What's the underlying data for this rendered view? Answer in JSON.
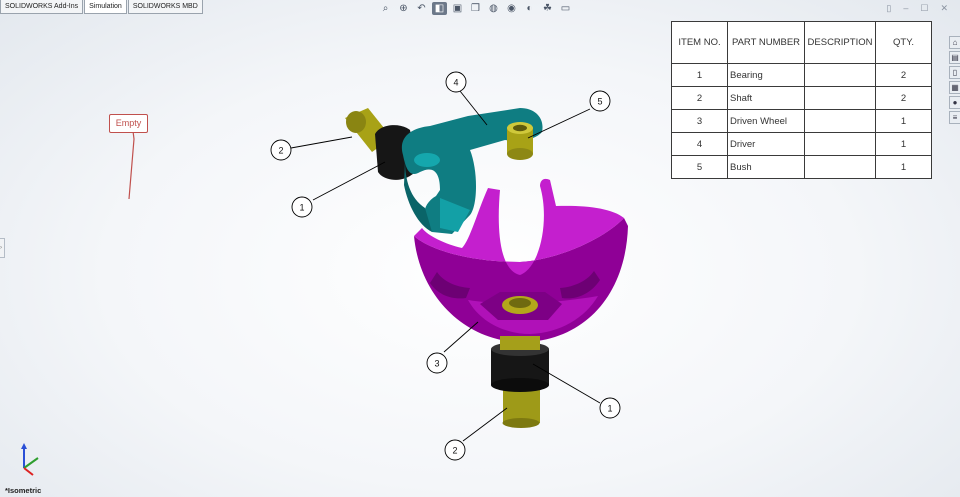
{
  "tabs": [
    "SOLIDWORKS Add-Ins",
    "Simulation",
    "SOLIDWORKS MBD"
  ],
  "heads_up_toolbar": [
    {
      "icon": "zoom-to-fit-icon"
    },
    {
      "icon": "zoom-to-area-icon"
    },
    {
      "icon": "previous-view-icon"
    },
    {
      "icon": "section-view-icon",
      "pressed": true
    },
    {
      "icon": "dynamic-annotation-views-icon"
    },
    {
      "icon": "view-orientation-icon"
    },
    {
      "icon": "display-style-icon"
    },
    {
      "icon": "hide-show-items-icon"
    },
    {
      "icon": "edit-appearance-icon"
    },
    {
      "icon": "apply-scene-icon"
    },
    {
      "icon": "view-settings-icon"
    }
  ],
  "window_controls": {
    "restore": "▯",
    "minimize": "–",
    "maximize": "☐",
    "close": "✕"
  },
  "task_pane": [
    "home-icon",
    "design-library-icon",
    "file-explorer-icon",
    "view-palette-icon",
    "appearances-icon",
    "custom-properties-icon"
  ],
  "note": {
    "text": "Empty"
  },
  "bom": {
    "headers": [
      "ITEM NO.",
      "PART NUMBER",
      "DESCRIPTION",
      "QTY."
    ],
    "rows": [
      {
        "item": "1",
        "part": "Bearing",
        "description": "",
        "qty": "2"
      },
      {
        "item": "2",
        "part": "Shaft",
        "description": "",
        "qty": "2"
      },
      {
        "item": "3",
        "part": "Driven Wheel",
        "description": "",
        "qty": "1"
      },
      {
        "item": "4",
        "part": "Driver",
        "description": "",
        "qty": "1"
      },
      {
        "item": "5",
        "part": "Bush",
        "description": "",
        "qty": "1"
      }
    ]
  },
  "balloons": [
    "4",
    "5",
    "2",
    "1",
    "3",
    "1",
    "2"
  ],
  "view_label": "*Isometric",
  "colors": {
    "driven_wheel": "#a000a8",
    "driver": "#0f7d82",
    "shaft_bush": "#a8a216",
    "bearing": "#151515",
    "note_border": "#c0504d"
  }
}
